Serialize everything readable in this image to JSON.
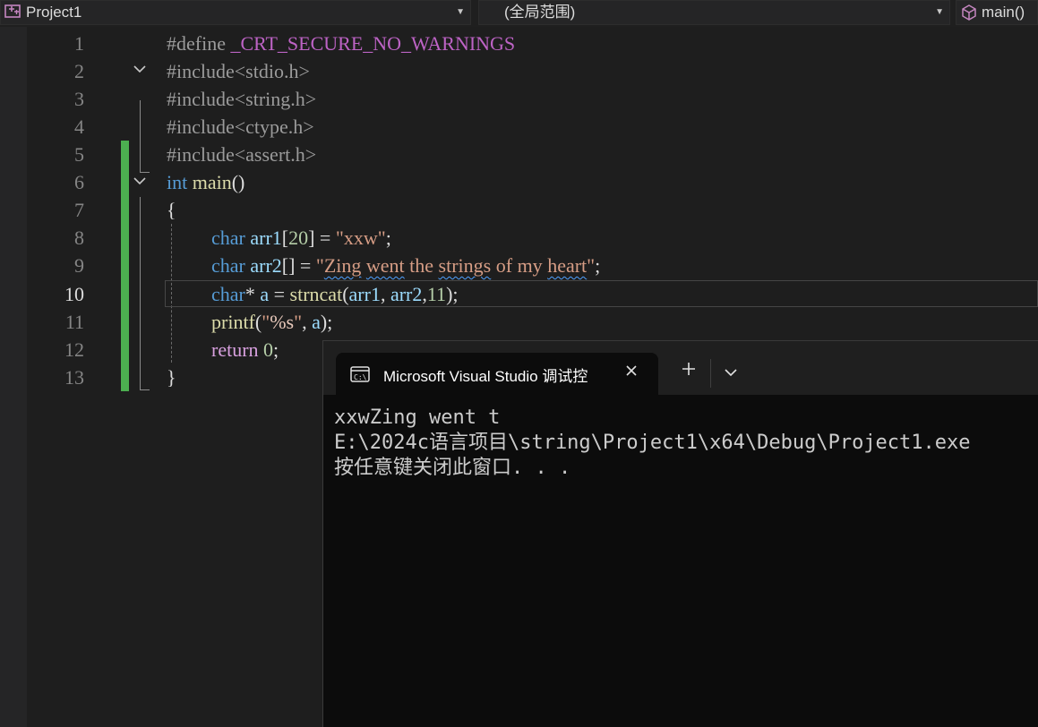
{
  "navbar": {
    "project": "Project1",
    "scope": "(全局范围)",
    "member": "main()"
  },
  "line_numbers": [
    "1",
    "2",
    "3",
    "4",
    "5",
    "6",
    "7",
    "8",
    "9",
    "10",
    "11",
    "12",
    "13"
  ],
  "active_line": "10",
  "code": {
    "l1_directive": "#define",
    "l1_macro": "_CRT_SECURE_NO_WARNINGS",
    "l2": "#include<stdio.h>",
    "l3": "#include<string.h>",
    "l4": "#include<ctype.h>",
    "l5": "#include<assert.h>",
    "l6_type": "int",
    "l6_name": "main",
    "l6_parens": "()",
    "l7": "{",
    "l8_type": "char",
    "l8_var": "arr1",
    "l8_open": "[",
    "l8_num": "20",
    "l8_close": "] = ",
    "l8_str": "\"xxw\"",
    "l8_end": ";",
    "l9_type": "char",
    "l9_var": "arr2",
    "l9_mid": "[] = ",
    "l9_q1": "\"",
    "l9_w1": "Zing",
    "l9_w2": "went",
    "l9_w3": "the",
    "l9_w4": "strings",
    "l9_w5": "of",
    "l9_w6": "my",
    "l9_w7": "heart",
    "l9_q2": "\"",
    "l9_end": ";",
    "l10_type": "char",
    "l10_star": "* ",
    "l10_var": "a",
    "l10_eq": " = ",
    "l10_fn": "strncat",
    "l10_open": "(",
    "l10_a1": "arr1",
    "l10_comma": ", ",
    "l10_a2": "arr2",
    "l10_c2": ",",
    "l10_num": "11",
    "l10_end": ");",
    "l11_fn": "printf",
    "l11_open": "(",
    "l11_q1": "\"",
    "l11_fmt": "%s",
    "l11_q2": "\"",
    "l11_comma": ", ",
    "l11_var": "a",
    "l11_end": ");",
    "l12_kw": "return",
    "l12_num": "0",
    "l12_end": ";",
    "l13": "}"
  },
  "console": {
    "tab_title": "Microsoft Visual Studio 调试控",
    "output": [
      "xxwZing went t",
      "E:\\2024c语言项目\\string\\Project1\\x64\\Debug\\Project1.exe",
      "按任意键关闭此窗口. . ."
    ]
  },
  "colors": {
    "keyword": "#569cd6",
    "function": "#dcdcaa",
    "variable": "#9cdcfe",
    "string": "#d69d85",
    "number": "#b5cea8",
    "macro": "#bd63c5",
    "change_bar": "#4caf50"
  },
  "icons": [
    "project-icon",
    "dropdown-arrow-icon",
    "member-cube-icon",
    "fold-chevron-icon",
    "console-app-icon",
    "close-icon",
    "plus-icon",
    "chevron-down-icon"
  ]
}
